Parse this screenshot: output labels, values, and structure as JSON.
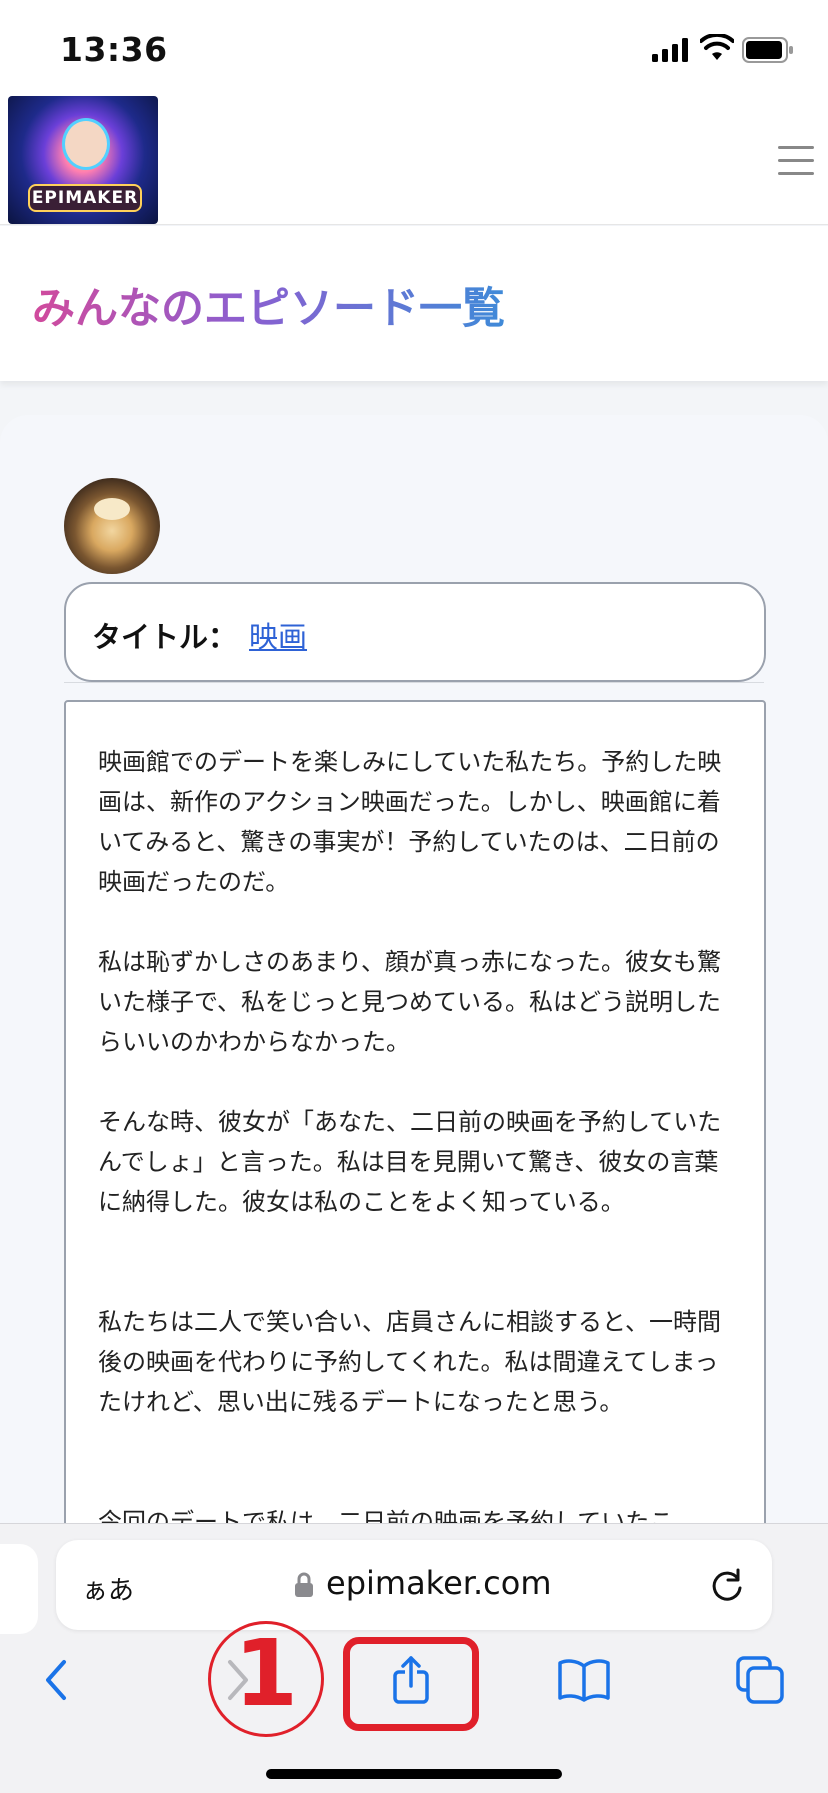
{
  "status_bar": {
    "time": "13:36"
  },
  "header": {
    "logo_text": "EPIMAKER"
  },
  "page": {
    "title": "みんなのエピソード一覧"
  },
  "episode": {
    "title_label": "タイトル：",
    "title_value": "映画",
    "paragraphs": [
      "映画館でのデートを楽しみにしていた私たち。予約した映画は、新作のアクション映画だった。しかし、映画館に着いてみると、驚きの事実が！予約していたのは、二日前の映画だったのだ。",
      "私は恥ずかしさのあまり、顔が真っ赤になった。彼女も驚いた様子で、私をじっと見つめている。私はどう説明したらいいのかわからなかった。",
      "そんな時、彼女が「あなた、二日前の映画を予約していたんでしょ」と言った。私は目を見開いて驚き、彼女の言葉に納得した。彼女は私のことをよく知っている。",
      "私たちは二人で笑い合い、店員さんに相談すると、一時間後の映画を代わりに予約してくれた。私は間違えてしまったけれど、思い出に残るデートになったと思う。",
      "今回のデートで私は、二日前の映画を予約していたこ"
    ]
  },
  "browser": {
    "text_size_label": "ぁあ",
    "url": "epimaker.com"
  },
  "annotation": {
    "step_number": "1"
  },
  "colors": {
    "annotation_red": "#e0202a",
    "link_blue": "#2e62d6",
    "ios_blue": "#1a73e8"
  },
  "icons": [
    "signal-icon",
    "wifi-icon",
    "battery-icon",
    "hamburger-menu-icon",
    "lock-icon",
    "reload-icon",
    "back-icon",
    "forward-icon",
    "share-icon",
    "bookmarks-icon",
    "tabs-icon"
  ]
}
